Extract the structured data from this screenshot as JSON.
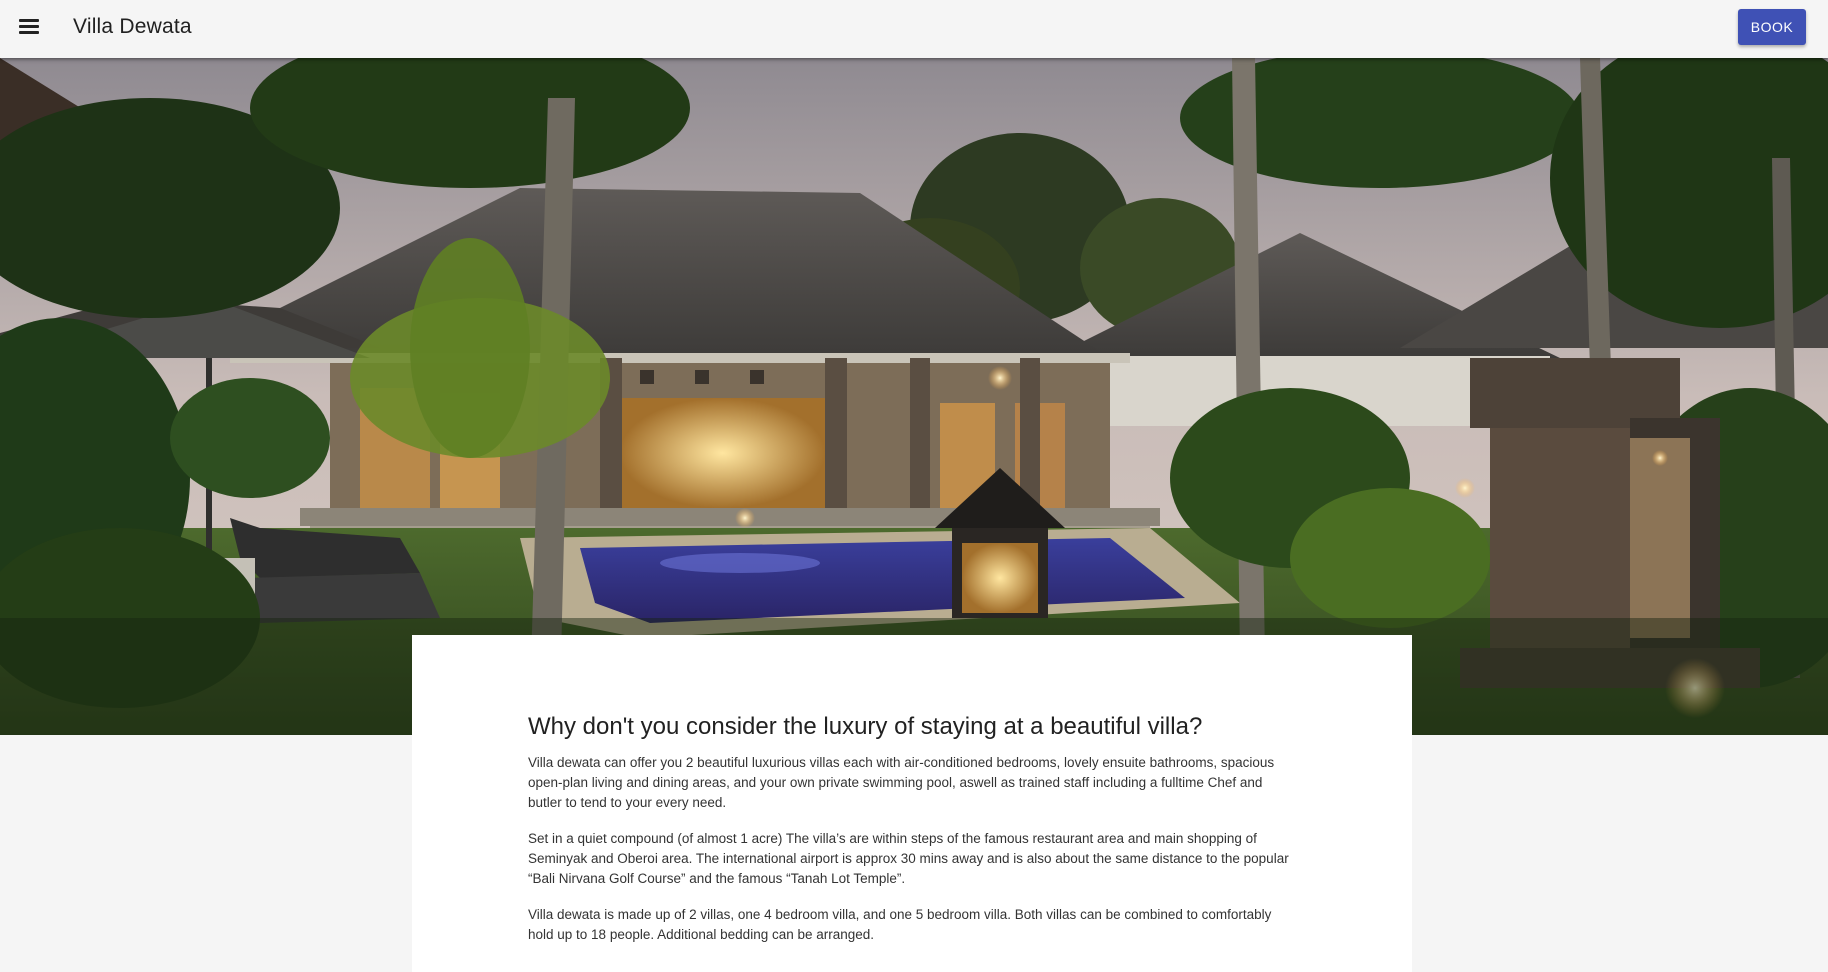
{
  "header": {
    "title": "Villa Dewata",
    "book_label": "BOOK",
    "menu_icon": "hamburger-menu-icon"
  },
  "colors": {
    "primary": "#3f51b5",
    "app_bar": "#f5f5f5",
    "background": "#f5f5f5",
    "card": "#ffffff"
  },
  "content": {
    "headline": "Why don't you consider the luxury of staying at a beautiful villa?",
    "paragraphs": [
      "Villa dewata can offer you 2 beautiful luxurious villas each with air-conditioned bedrooms, lovely ensuite bathrooms, spacious open-plan living and dining areas, and your own private swimming pool, aswell as trained staff including a fulltime Chef and butler to tend to your every need.",
      "Set in a quiet compound (of almost 1 acre) The villa’s are within steps of the famous restaurant area and main shopping of Seminyak and Oberoi area. The international airport is approx 30 mins away and is also about the same distance to the popular “Bali Nirvana Golf Course” and the famous “Tanah Lot Temple”.",
      "Villa dewata is made up of 2 villas, one 4 bedroom villa, and one 5 bedroom villa. Both villas can be combined to comfortably hold up to 18 people. Additional bedding can be arranged."
    ]
  }
}
